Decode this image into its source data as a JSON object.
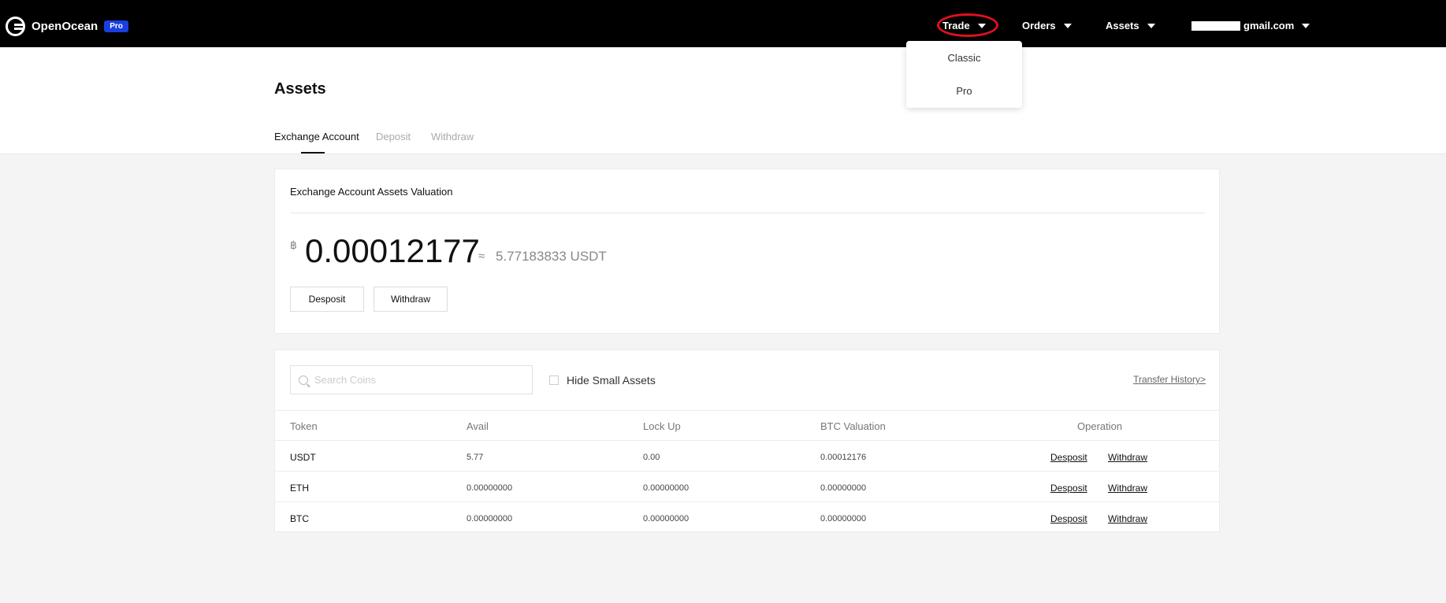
{
  "nav": {
    "brand": "OpenOcean",
    "badge": "Pro",
    "trade": "Trade",
    "orders": "Orders",
    "assets": "Assets",
    "account_suffix": "gmail.com"
  },
  "trade_menu": {
    "items": [
      "Classic",
      "Pro"
    ]
  },
  "page": {
    "title": "Assets",
    "tabs": [
      "Exchange Account",
      "Deposit",
      "Withdraw"
    ]
  },
  "valuation": {
    "title": "Exchange Account Assets Valuation",
    "btc_symbol": "฿",
    "btc_value": "0.00012177",
    "approx_symbol": "≈",
    "usdt_value": "5.77183833 USDT",
    "deposit_label": "Desposit",
    "withdraw_label": "Withdraw"
  },
  "assets_table": {
    "search_placeholder": "Search Coins",
    "hide_small_label": "Hide Small Assets",
    "transfer_history": "Transfer History>",
    "columns": [
      "Token",
      "Avail",
      "Lock Up",
      "BTC Valuation",
      "Operation"
    ],
    "rows": [
      {
        "token": "USDT",
        "avail": "5.77",
        "lock": "0.00",
        "btc": "0.00012176",
        "deposit": "Desposit",
        "withdraw": "Withdraw"
      },
      {
        "token": "ETH",
        "avail": "0.00000000",
        "lock": "0.00000000",
        "btc": "0.00000000",
        "deposit": "Desposit",
        "withdraw": "Withdraw"
      },
      {
        "token": "BTC",
        "avail": "0.00000000",
        "lock": "0.00000000",
        "btc": "0.00000000",
        "deposit": "Desposit",
        "withdraw": "Withdraw"
      }
    ]
  },
  "icons": {
    "logo": "openocean-logo-icon",
    "caret": "caret-down-icon",
    "search": "search-icon",
    "checkbox": "checkbox-icon"
  },
  "colors": {
    "nav_bg": "#000000",
    "badge": "#1a3fe0",
    "highlight_ring": "#e0101c",
    "page_bg": "#f4f4f4"
  }
}
